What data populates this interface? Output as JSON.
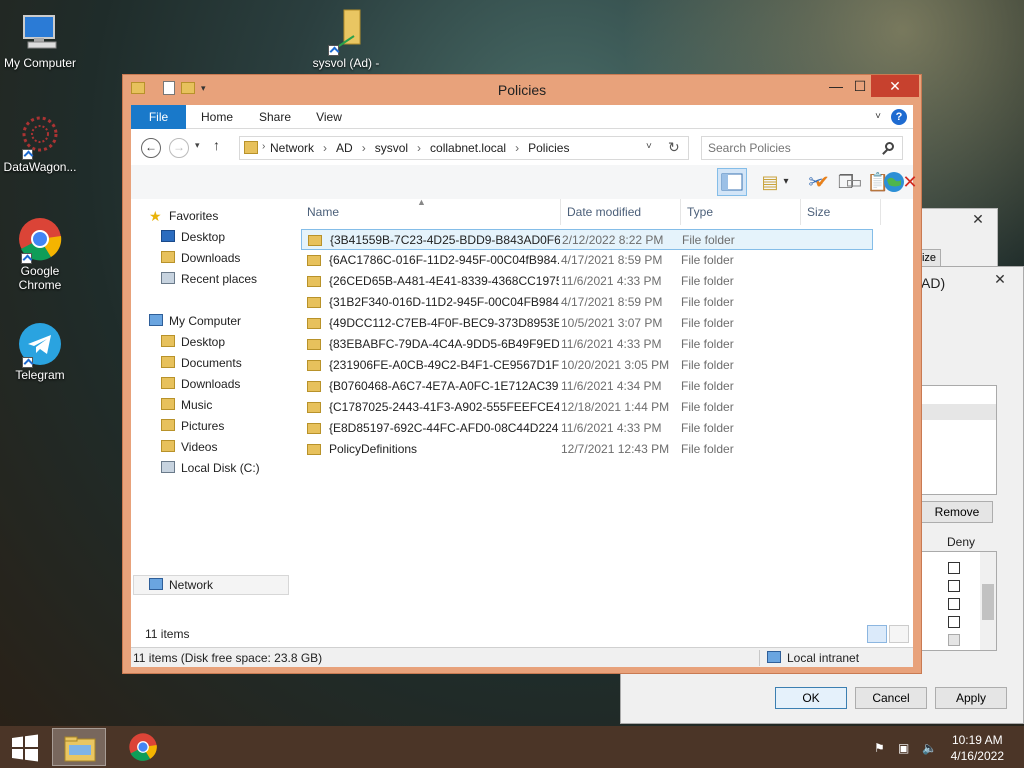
{
  "desktop": {
    "icons": [
      {
        "label": "My Computer"
      },
      {
        "label": "sysvol (Ad) -"
      },
      {
        "label": "DataWagon..."
      },
      {
        "label": "Google Chrome"
      },
      {
        "label": "Telegram"
      }
    ]
  },
  "explorer": {
    "title": "Policies",
    "ribbon_tabs": [
      "File",
      "Home",
      "Share",
      "View"
    ],
    "breadcrumb": [
      "Network",
      "AD",
      "sysvol",
      "collabnet.local",
      "Policies"
    ],
    "search_placeholder": "Search Policies",
    "columns": {
      "name": "Name",
      "date": "Date modified",
      "type": "Type",
      "size": "Size"
    },
    "nav": {
      "favorites": "Favorites",
      "fav_items": [
        "Desktop",
        "Downloads",
        "Recent places"
      ],
      "computer": "My Computer",
      "comp_items": [
        "Desktop",
        "Documents",
        "Downloads",
        "Music",
        "Pictures",
        "Videos",
        "Local Disk (C:)"
      ],
      "network": "Network"
    },
    "files": [
      {
        "name": "{3B41559B-7C23-4D25-BDD9-B843AD0F6...",
        "date": "2/12/2022 8:22 PM",
        "type": "File folder"
      },
      {
        "name": "{6AC1786C-016F-11D2-945F-00C04fB984...",
        "date": "4/17/2021 8:59 PM",
        "type": "File folder"
      },
      {
        "name": "{26CED65B-A481-4E41-8339-4368CC1975...",
        "date": "11/6/2021 4:33 PM",
        "type": "File folder"
      },
      {
        "name": "{31B2F340-016D-11D2-945F-00C04FB984...",
        "date": "4/17/2021 8:59 PM",
        "type": "File folder"
      },
      {
        "name": "{49DCC112-C7EB-4F0F-BEC9-373D8953E...",
        "date": "10/5/2021 3:07 PM",
        "type": "File folder"
      },
      {
        "name": "{83EBABFC-79DA-4C4A-9DD5-6B49F9ED...",
        "date": "11/6/2021 4:33 PM",
        "type": "File folder"
      },
      {
        "name": "{231906FE-A0CB-49C2-B4F1-CE9567D1F0...",
        "date": "10/20/2021 3:05 PM",
        "type": "File folder"
      },
      {
        "name": "{B0760468-A6C7-4E7A-A0FC-1E712AC39...",
        "date": "11/6/2021 4:34 PM",
        "type": "File folder"
      },
      {
        "name": "{C1787025-2443-41F3-A902-555FEEFCE4...",
        "date": "12/18/2021 1:44 PM",
        "type": "File folder"
      },
      {
        "name": "{E8D85197-692C-44FC-AFD0-08C44D224...",
        "date": "11/6/2021 4:33 PM",
        "type": "File folder"
      },
      {
        "name": "PolicyDefinitions",
        "date": "12/7/2021 12:43 PM",
        "type": "File folder"
      }
    ],
    "item_count": "11 items",
    "status_text": "11 items (Disk free space: 23.8 GB)",
    "zone": "Local intranet"
  },
  "background_dialog": {
    "title_fragment": "AD)",
    "ize_fragment": "ize",
    "remove_label": "Remove",
    "deny_label": "Deny",
    "ok_label": "OK",
    "cancel_label": "Cancel",
    "apply_label": "Apply"
  },
  "taskbar": {
    "time": "10:19 AM",
    "date": "4/16/2022"
  },
  "colors": {
    "window_frame": "#e8a27b",
    "accent": "#1979ca",
    "close": "#c7412e",
    "taskbar": "#4b3527"
  }
}
